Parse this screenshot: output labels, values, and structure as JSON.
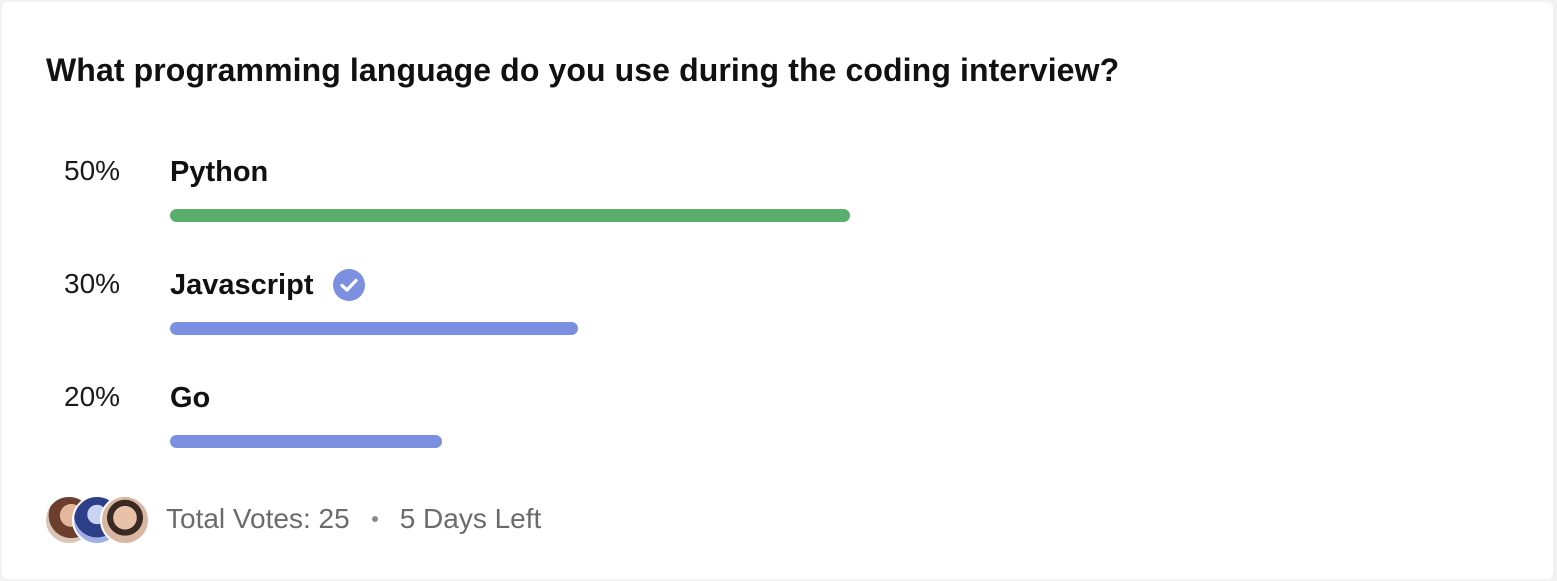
{
  "poll": {
    "question": "What programming language do you use during the coding interview?",
    "options": [
      {
        "percent_label": "50%",
        "label": "Python",
        "percent": 50,
        "color": "#5aae6b",
        "selected": false
      },
      {
        "percent_label": "30%",
        "label": "Javascript",
        "percent": 30,
        "color": "#7b90e0",
        "selected": true
      },
      {
        "percent_label": "20%",
        "label": "Go",
        "percent": 20,
        "color": "#7b90e0",
        "selected": false
      }
    ],
    "selected_icon": "check-circle-icon",
    "selected_icon_color": "#7b90e0"
  },
  "footer": {
    "total_votes": "Total Votes: 25",
    "separator": "•",
    "time_left": "5 Days Left",
    "avatars": [
      "avatar-1",
      "avatar-2",
      "avatar-3"
    ]
  }
}
